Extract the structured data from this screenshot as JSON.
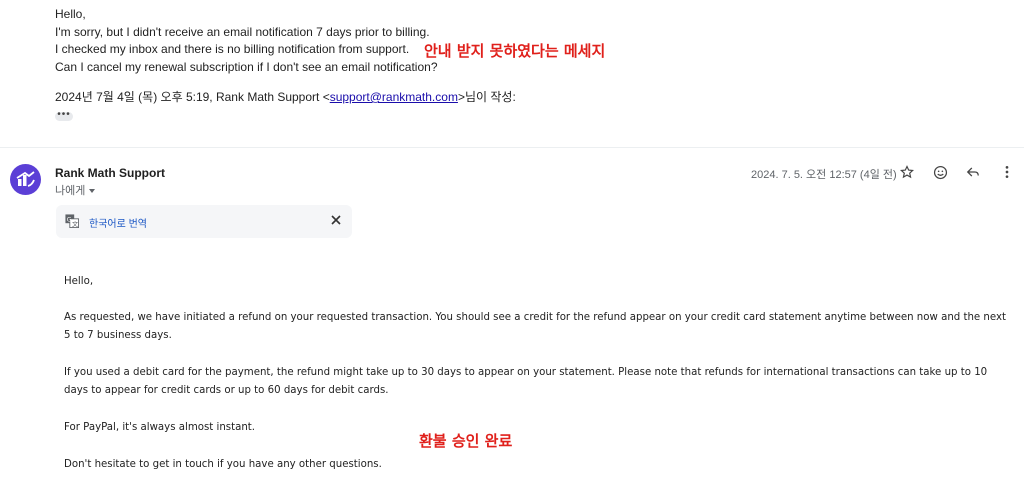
{
  "quoted": {
    "lines": [
      "Hello,",
      "I'm sorry, but I didn't receive an email notification 7 days prior to billing.",
      "I checked my inbox and there is no billing notification from support.",
      "Can I cancel my renewal subscription if I don't see an email notification?"
    ],
    "wrote_prefix": "2024년 7월 4일 (목) 오후 5:19, Rank Math Support <",
    "wrote_email": "support@rankmath.com",
    "wrote_suffix": ">님이 작성:",
    "dots": "•••"
  },
  "annotations": {
    "top": "안내 받지 못하였다는 메세지",
    "bottom": "환불 승인 완료"
  },
  "message": {
    "sender": "Rank Math Support",
    "to_me": "나에게",
    "date": "2024. 7. 5. 오전 12:57 (4일 전)",
    "translate_label": "한국어로 번역",
    "paragraphs": {
      "p1": "Hello,",
      "p2a": "As requested, we have initiated a refund on your requested transaction. You should see a credit for the refund appear on your credit card statement anytime between now and the next",
      "p2b": "5 to 7 business days.",
      "p3a": "If you used a debit card for the payment, the refund might take up to 30 days to appear on your statement. Please note that refunds for international transactions can take up to 10",
      "p3b": "days to appear for credit cards or up to 60 days for debit cards.",
      "p4": "For PayPal, it's always almost instant.",
      "p5": "Don't hesitate to get in touch if you have any other questions."
    }
  },
  "colors": {
    "annotation": "#e0201b",
    "avatar": "#5b3fd6",
    "link": "#1a0dab",
    "translate_link": "#1a56c4"
  },
  "icons": [
    "star-icon",
    "emoji-icon",
    "reply-icon",
    "more-vert-icon",
    "translate-icon",
    "close-icon",
    "rank-math-logo-icon"
  ]
}
